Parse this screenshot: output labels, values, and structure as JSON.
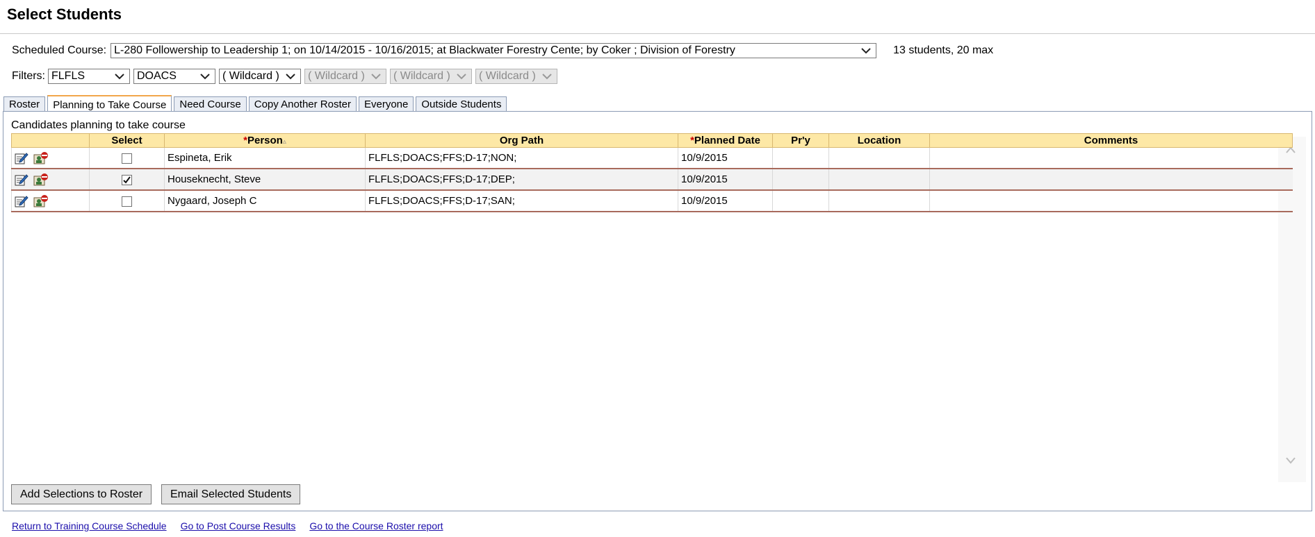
{
  "page": {
    "title": "Select Students"
  },
  "course": {
    "label": "Scheduled Course:",
    "value": "L-280 Followership to Leadership 1; on 10/14/2015 - 10/16/2015; at Blackwater Forestry Cente; by Coker ; Division of Forestry",
    "count": "13 students, 20 max"
  },
  "filters": {
    "label": "Filters:",
    "items": [
      {
        "value": "FLFLS",
        "disabled": false
      },
      {
        "value": "DOACS",
        "disabled": false
      },
      {
        "value": "( Wildcard )",
        "disabled": false
      },
      {
        "value": "( Wildcard )",
        "disabled": true
      },
      {
        "value": "( Wildcard )",
        "disabled": true
      },
      {
        "value": "( Wildcard )",
        "disabled": true
      }
    ]
  },
  "tabs": [
    {
      "label": "Roster",
      "active": false
    },
    {
      "label": "Planning to Take Course",
      "active": true
    },
    {
      "label": "Need Course",
      "active": false
    },
    {
      "label": "Copy Another Roster",
      "active": false
    },
    {
      "label": "Everyone",
      "active": false
    },
    {
      "label": "Outside Students",
      "active": false
    }
  ],
  "panel": {
    "caption": "Candidates planning to take course"
  },
  "table": {
    "headers": {
      "select": "Select",
      "person_req": "*",
      "person": "Person",
      "person_sort": "▵",
      "org_path": "Org Path",
      "planned_req": "*",
      "planned_date": "Planned Date",
      "priority": "Pr'y",
      "location": "Location",
      "comments": "Comments"
    },
    "rows": [
      {
        "person": "Espineta, Erik",
        "org_path": "FLFLS;DOACS;FFS;D-17;NON;",
        "planned_date": "10/9/2015",
        "priority": "",
        "location": "",
        "comments": "",
        "checked": false
      },
      {
        "person": "Houseknecht, Steve",
        "org_path": "FLFLS;DOACS;FFS;D-17;DEP;",
        "planned_date": "10/9/2015",
        "priority": "",
        "location": "",
        "comments": "",
        "checked": true
      },
      {
        "person": "Nygaard, Joseph C",
        "org_path": "FLFLS;DOACS;FFS;D-17;SAN;",
        "planned_date": "10/9/2015",
        "priority": "",
        "location": "",
        "comments": "",
        "checked": false
      }
    ]
  },
  "buttons": {
    "add": "Add Selections to Roster",
    "email": "Email Selected Students"
  },
  "links": {
    "schedule": "Return to Training Course Schedule",
    "post_results": "Go to Post Course Results",
    "roster_report": "Go to the Course Roster report"
  },
  "icons": {
    "edit": "edit-icon",
    "remove": "remove-person-icon",
    "chevron": "chevron-down-icon"
  },
  "colors": {
    "header_bg": "#fde8a6",
    "row_rule": "#a86a5c",
    "tab_active_accent": "#f2a64a",
    "link": "#1a0dab"
  }
}
